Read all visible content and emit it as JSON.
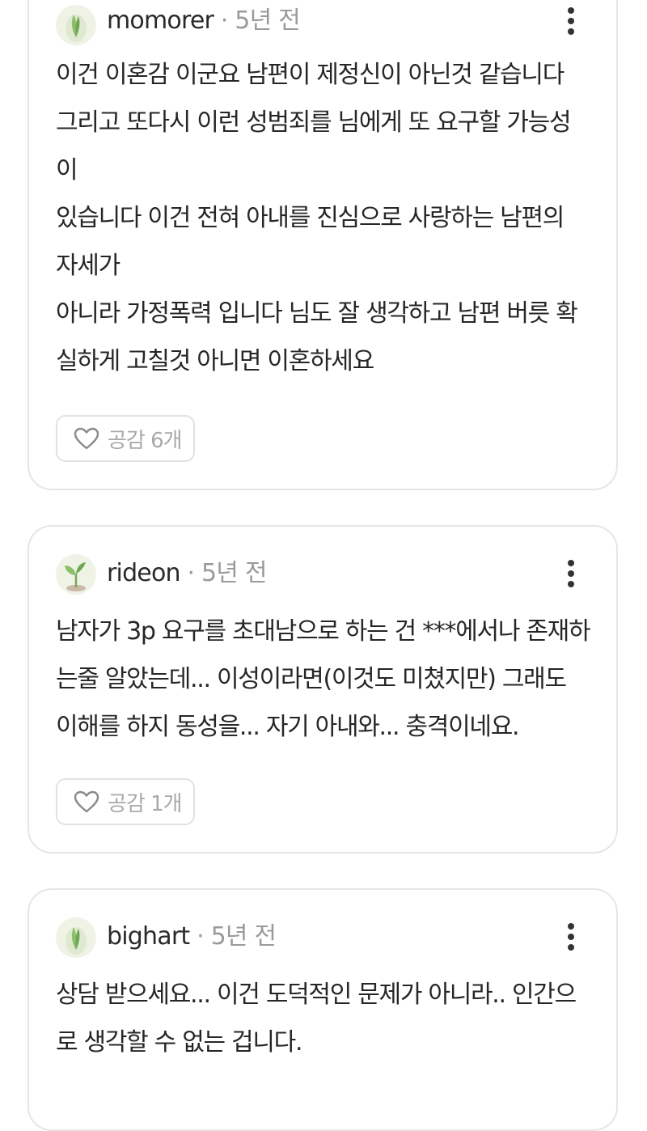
{
  "comments": [
    {
      "author": "momorer",
      "time": "5년 전",
      "lines": [
        "이건 이혼감 이군요 남편이 제정신이 아닌것 같습니다",
        "그리고 또다시 이런 성범죄를 님에게 또 요구할 가능성",
        "이",
        "있습니다 이건 전혀 아내를 진심으로 사랑하는 남편의",
        "자세가",
        "아니라 가정폭력 입니다 님도 잘 생각하고 남편 버릇 확",
        "실하게 고칠것 아니면 이혼하세요"
      ],
      "like_label": "공감 6개",
      "avatar_icon": "sprout-icon"
    },
    {
      "author": "rideon",
      "time": "5년 전",
      "lines": [
        "남자가 3p 요구를 초대남으로 하는 건 ***에서나 존재하",
        "는줄 알았는데... 이성이라면(이것도 미쳤지만) 그래도",
        "이해를 하지 동성을... 자기 아내와... 충격이네요."
      ],
      "like_label": "공감 1개",
      "avatar_icon": "seedling-icon"
    },
    {
      "author": "bighart",
      "time": "5년 전",
      "lines": [
        "상담 받으세요... 이건 도덕적인 문제가 아니라.. 인간으",
        "로 생각할 수 없는 겁니다."
      ],
      "like_label": "",
      "avatar_icon": "sprout-icon"
    }
  ],
  "separator": "·",
  "colors": {
    "card_border": "#e6e6e6",
    "meta_gray": "#9a9a9a",
    "text": "#262626",
    "avatar_green": "#7fb069"
  }
}
